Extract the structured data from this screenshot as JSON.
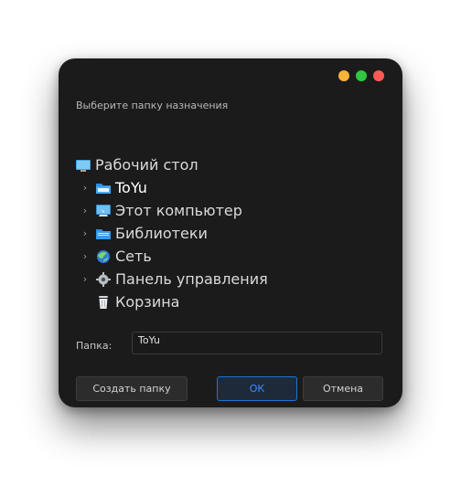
{
  "window": {
    "prompt": "Выберите папку назначения"
  },
  "tree": {
    "root": {
      "label": "Рабочий стол",
      "icon": "desktop-icon"
    },
    "items": [
      {
        "label": "ToYu",
        "icon": "folder-icon",
        "expandable": true,
        "selected": true
      },
      {
        "label": "Этот компьютер",
        "icon": "computer-icon",
        "expandable": true
      },
      {
        "label": "Библиотеки",
        "icon": "libraries-icon",
        "expandable": true
      },
      {
        "label": "Сеть",
        "icon": "network-icon",
        "expandable": true
      },
      {
        "label": "Панель управления",
        "icon": "control-panel-icon",
        "expandable": true
      },
      {
        "label": "Корзина",
        "icon": "recycle-bin-icon",
        "expandable": false
      }
    ]
  },
  "folder": {
    "label": "Папка:",
    "value": "ToYu"
  },
  "buttons": {
    "create": "Создать папку",
    "ok": "ОК",
    "cancel": "Отмена"
  },
  "colors": {
    "window_bg": "#1b1b1b",
    "accent": "#1b74d4",
    "close": "#fb5b54",
    "minimize": "#f6b33a",
    "maximize": "#2fc740"
  }
}
